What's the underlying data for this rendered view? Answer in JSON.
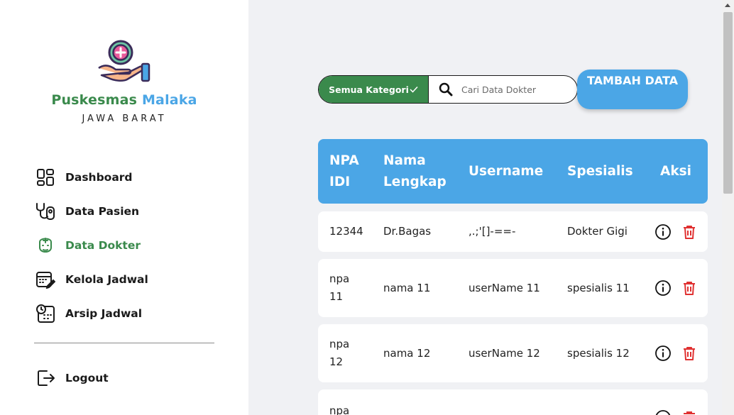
{
  "brand": {
    "part1": "Puskesmas",
    "part2": "Malaka",
    "region": "JAWA BARAT"
  },
  "nav": [
    {
      "label": "Dashboard",
      "icon": "dashboard-icon",
      "active": false
    },
    {
      "label": "Data Pasien",
      "icon": "stethoscope-icon",
      "active": false
    },
    {
      "label": "Data Dokter",
      "icon": "doctor-icon",
      "active": true
    },
    {
      "label": "Kelola Jadwal",
      "icon": "calendar-edit-icon",
      "active": false
    },
    {
      "label": "Arsip Jadwal",
      "icon": "schedule-archive-icon",
      "active": false
    }
  ],
  "logout": {
    "label": "Logout",
    "icon": "logout-icon"
  },
  "toolbar": {
    "category_label": "Semua Kategori",
    "search_placeholder": "Cari Data Dokter",
    "add_button": "TAMBAH DATA"
  },
  "table": {
    "headers": {
      "npa": "NPA IDI",
      "nama": "Nama Lengkap",
      "username": "Username",
      "spesialis": "Spesialis",
      "aksi": "Aksi"
    },
    "rows": [
      {
        "npa": "12344",
        "nama": "Dr.Bagas",
        "username": ",.;'[]-==-",
        "spesialis": "Dokter Gigi"
      },
      {
        "npa": "npa 11",
        "nama": "nama 11",
        "username": "userName 11",
        "spesialis": "spesialis 11"
      },
      {
        "npa": "npa 12",
        "nama": "nama 12",
        "username": "userName 12",
        "spesialis": "spesialis 12"
      },
      {
        "npa": "npa",
        "nama": "",
        "username": "",
        "spesialis": ""
      }
    ]
  },
  "colors": {
    "green": "#3a8a4c",
    "blue": "#4ba6e6",
    "delete_red": "#e03131"
  }
}
